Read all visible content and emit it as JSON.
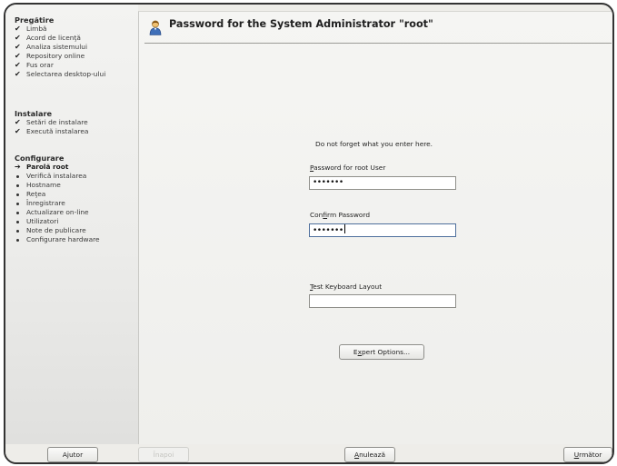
{
  "sidebar": {
    "sections": [
      {
        "heading": "Pregătire",
        "items": [
          {
            "label": "Limbă",
            "status": "done"
          },
          {
            "label": "Acord de licenţă",
            "status": "done"
          },
          {
            "label": "Analiza sistemului",
            "status": "done"
          },
          {
            "label": "Repository online",
            "status": "done"
          },
          {
            "label": "Fus orar",
            "status": "done"
          },
          {
            "label": "Selectarea desktop-ului",
            "status": "done"
          }
        ]
      },
      {
        "heading": "Instalare",
        "items": [
          {
            "label": "Setări de instalare",
            "status": "done"
          },
          {
            "label": "Execută instalarea",
            "status": "done"
          }
        ]
      },
      {
        "heading": "Configurare",
        "items": [
          {
            "label": "Parolă root",
            "status": "current"
          },
          {
            "label": "Verifică instalarea",
            "status": "pending"
          },
          {
            "label": "Hostname",
            "status": "pending"
          },
          {
            "label": "Reţea",
            "status": "pending"
          },
          {
            "label": "Înregistrare",
            "status": "pending"
          },
          {
            "label": "Actualizare on-line",
            "status": "pending"
          },
          {
            "label": "Utilizatori",
            "status": "pending"
          },
          {
            "label": "Note de publicare",
            "status": "pending"
          },
          {
            "label": "Configurare hardware",
            "status": "pending"
          }
        ]
      }
    ],
    "marks": {
      "done": "✔",
      "current": "➔"
    }
  },
  "main": {
    "title": "Password for the System Administrator \"root\"",
    "note": "Do not forget what you enter here.",
    "password_label_mn": "P",
    "password_label_rest": "assword for root User",
    "password_value": "•••••••",
    "confirm_label_pre": "Con",
    "confirm_label_mn": "f",
    "confirm_label_rest": "irm Password",
    "confirm_value": "•••••••",
    "keyboard_label_mn": "T",
    "keyboard_label_rest": "est Keyboard Layout",
    "keyboard_value": "",
    "expert_pre": "E",
    "expert_mn": "x",
    "expert_rest": "pert Options..."
  },
  "footer": {
    "help": "Ajutor",
    "back": "Înapoi",
    "abort_mn": "A",
    "abort_rest": "nulează",
    "next_mn": "U",
    "next_rest": "rmător"
  },
  "colors": {
    "background": "#eeede9",
    "focus_border": "#4e6f9c"
  }
}
